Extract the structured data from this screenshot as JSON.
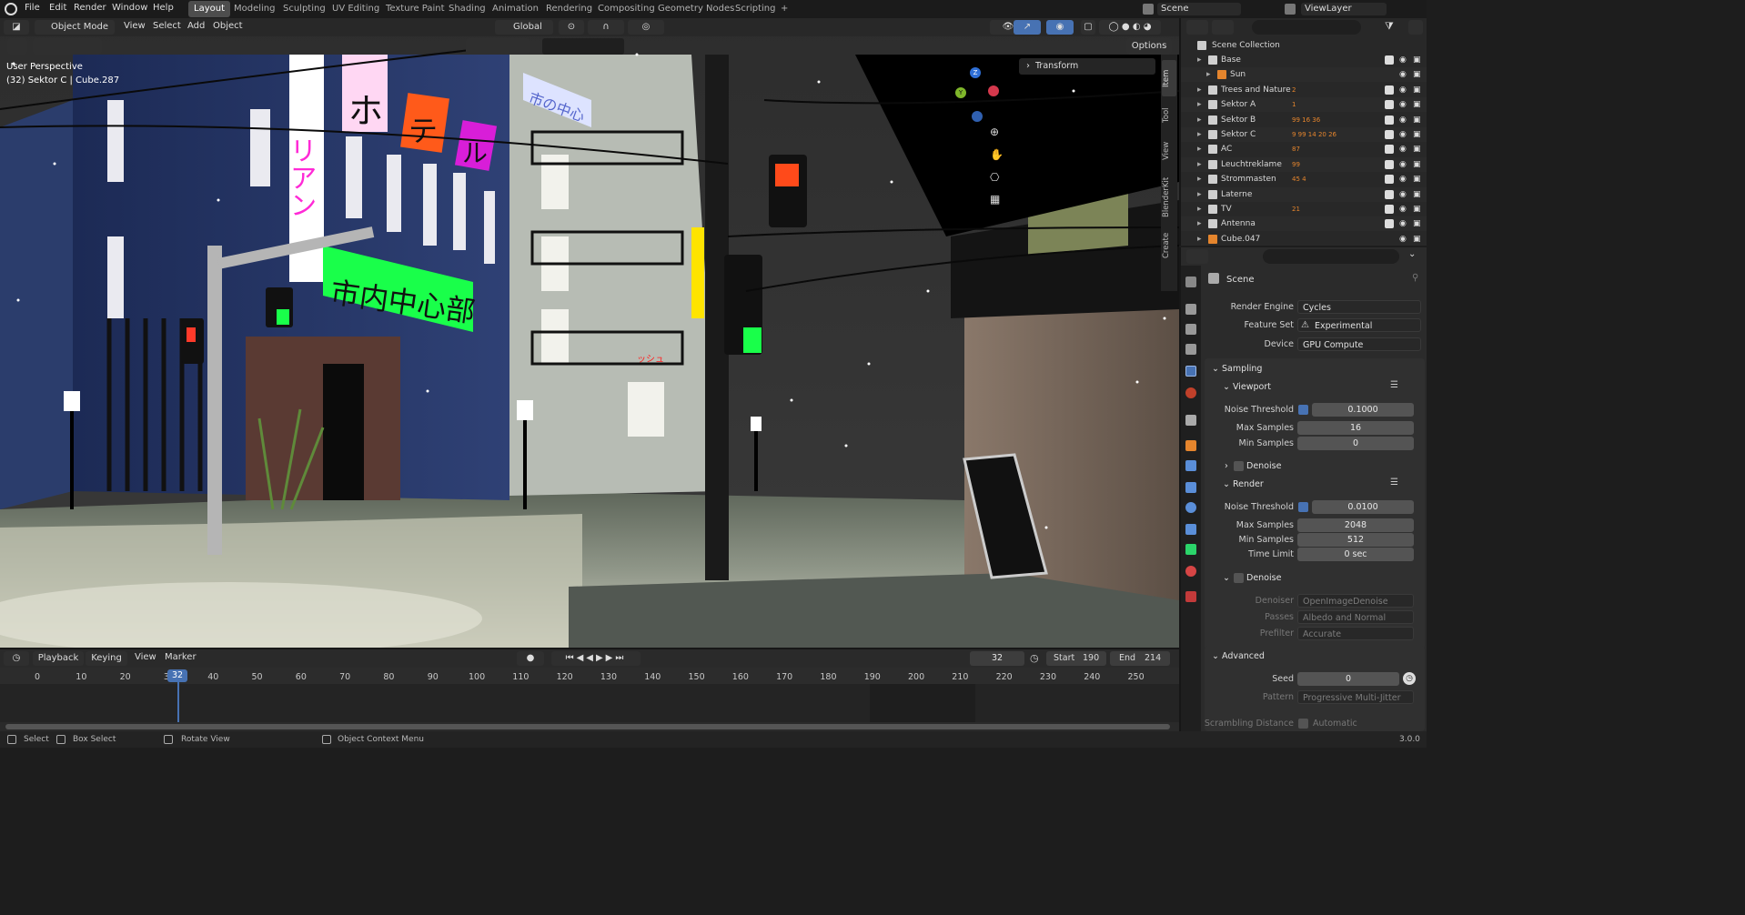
{
  "menu": {
    "items": [
      "File",
      "Edit",
      "Render",
      "Window",
      "Help"
    ],
    "workspaces": [
      "Layout",
      "Modeling",
      "Sculpting",
      "UV Editing",
      "Texture Paint",
      "Shading",
      "Animation",
      "Rendering",
      "Compositing",
      "Geometry Nodes",
      "Scripting",
      "+"
    ],
    "active_workspace": "Layout",
    "scene": "Scene",
    "view_layer": "ViewLayer"
  },
  "viewport": {
    "mode": "Object Mode",
    "menus": [
      "View",
      "Select",
      "Add",
      "Object"
    ],
    "orientation": "Global",
    "options": "Options",
    "overlay_text_1": "User Perspective",
    "overlay_text_2": "(32) Sektor C | Cube.287",
    "transform_panel": "Transform",
    "side_tabs": [
      "Item",
      "Tool",
      "View",
      "BlenderKit",
      "Create"
    ],
    "signs": {
      "hotel": [
        "ホ",
        "テ",
        "ル"
      ],
      "green": "市内中心部",
      "street": "市の中心",
      "vertical": "リアン",
      "shop": "ッシュ"
    }
  },
  "outliner": {
    "root": "Scene Collection",
    "items": [
      {
        "name": "Base",
        "extra": ""
      },
      {
        "name": "Sun",
        "extra": ""
      },
      {
        "name": "Trees and Nature",
        "extra": "2"
      },
      {
        "name": "Sektor A",
        "extra": "1"
      },
      {
        "name": "Sektor B",
        "extra": "99 16 36"
      },
      {
        "name": "Sektor C",
        "extra": "9 99 14 20 26"
      },
      {
        "name": "AC",
        "extra": "87"
      },
      {
        "name": "Leuchtreklame",
        "extra": "99"
      },
      {
        "name": "Strommasten",
        "extra": "45 4"
      },
      {
        "name": "Laterne",
        "extra": ""
      },
      {
        "name": "TV",
        "extra": "21"
      },
      {
        "name": "Antenna",
        "extra": ""
      },
      {
        "name": "Cube.047",
        "extra": ""
      }
    ]
  },
  "properties": {
    "context": "Scene",
    "render_engine_label": "Render Engine",
    "render_engine": "Cycles",
    "feature_set_label": "Feature Set",
    "feature_set": "Experimental",
    "device_label": "Device",
    "device": "GPU Compute",
    "sampling": "Sampling",
    "viewport": "Viewport",
    "noise_threshold_label": "Noise Threshold",
    "vp_noise_threshold": "0.1000",
    "max_samples_label": "Max Samples",
    "vp_max_samples": "16",
    "min_samples_label": "Min Samples",
    "vp_min_samples": "0",
    "denoise": "Denoise",
    "render": "Render",
    "r_noise_threshold": "0.0100",
    "r_max_samples": "2048",
    "r_min_samples": "512",
    "time_limit_label": "Time Limit",
    "time_limit": "0 sec",
    "denoiser_label": "Denoiser",
    "denoiser": "OpenImageDenoise",
    "passes_label": "Passes",
    "passes": "Albedo and Normal",
    "prefilter_label": "Prefilter",
    "prefilter": "Accurate",
    "advanced": "Advanced",
    "seed_label": "Seed",
    "seed": "0",
    "pattern_label": "Pattern",
    "pattern": "Progressive Multi-Jitter",
    "scrambling_label": "Scrambling Distance",
    "automatic": "Automatic"
  },
  "timeline": {
    "menus": [
      "Playback",
      "Keying",
      "View",
      "Marker"
    ],
    "current_frame": "32",
    "start_label": "Start",
    "start": "190",
    "end_label": "End",
    "end": "214",
    "ticks": [
      "0",
      "10",
      "20",
      "30",
      "40",
      "50",
      "60",
      "70",
      "80",
      "90",
      "100",
      "110",
      "120",
      "130",
      "140",
      "150",
      "160",
      "170",
      "180",
      "190",
      "200",
      "210",
      "220",
      "230",
      "240",
      "250"
    ]
  },
  "status": {
    "select": "Select",
    "box_select": "Box Select",
    "rotate": "Rotate View",
    "context_menu": "Object Context Menu",
    "version": "3.0.0"
  },
  "colors": {
    "accent": "#4772b3",
    "timeline_cursor": "#4772b3",
    "sign_green": "#19ff4a",
    "sign_orange": "#ff5a1a",
    "sign_magenta": "#d81ed8"
  }
}
